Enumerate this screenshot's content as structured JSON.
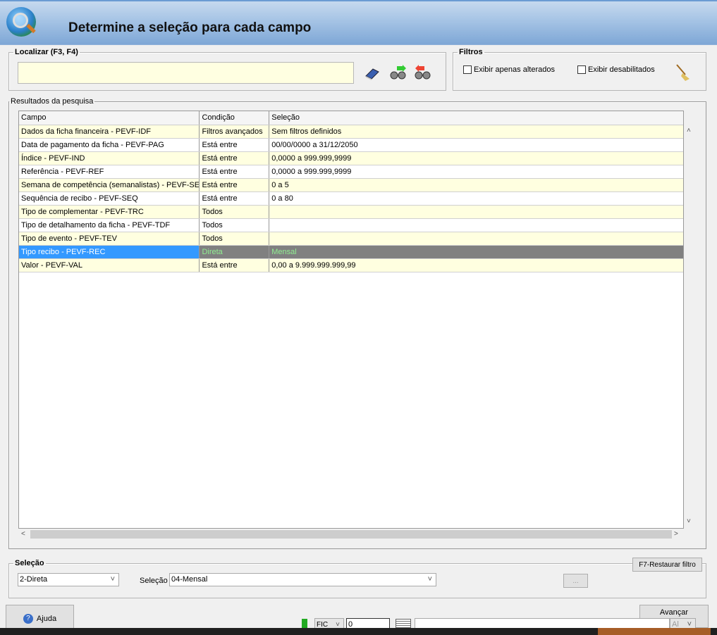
{
  "header": {
    "title": "Determine a seleção para cada campo",
    "icon": "globe-search-icon"
  },
  "localizar": {
    "legend": "Localizar (F3, F4)",
    "value": "",
    "icons": [
      "eraser-icon",
      "find-next-icon",
      "find-previous-icon"
    ]
  },
  "filtros": {
    "legend": "Filtros",
    "options": [
      {
        "label": "Exibir apenas alterados",
        "checked": false
      },
      {
        "label": "Exibir desabilitados",
        "checked": false
      }
    ],
    "icon": "broom-icon"
  },
  "results": {
    "legend": "Resultados da pesquisa",
    "columns": [
      "Campo",
      "Condição",
      "Seleção"
    ],
    "rows": [
      [
        "Dados da ficha financeira - PEVF-IDF",
        "Filtros avançados",
        "Sem filtros definidos"
      ],
      [
        "Data de pagamento da ficha - PEVF-PAG",
        "Está entre",
        "00/00/0000 a 31/12/2050"
      ],
      [
        "Índice - PEVF-IND",
        "Está entre",
        "0,0000 a 999.999,9999"
      ],
      [
        "Referência - PEVF-REF",
        "Está entre",
        "0,0000 a 999.999,9999"
      ],
      [
        "Semana de competência (semanalistas) - PEVF-SEM",
        "Está entre",
        "0 a 5"
      ],
      [
        "Sequência de recibo - PEVF-SEQ",
        "Está entre",
        "0 a 80"
      ],
      [
        "Tipo de complementar - PEVF-TRC",
        "Todos",
        ""
      ],
      [
        "Tipo de detalhamento da ficha - PEVF-TDF",
        "Todos",
        ""
      ],
      [
        "Tipo de evento - PEVF-TEV",
        "Todos",
        ""
      ],
      [
        "Tipo recibo - PEVF-REC",
        "Direta",
        "Mensal"
      ],
      [
        "Valor - PEVF-VAL",
        "Está entre",
        "0,00 a 9.999.999.999,99"
      ]
    ],
    "selected_row": 9
  },
  "selecao": {
    "legend": "Seleção",
    "restore_label": "F7-Restaurar filtro",
    "condition": "2-Direta",
    "value_label": "Seleção",
    "value": "04-Mensal",
    "ellipsis": "..."
  },
  "footer": {
    "help": "Ajuda",
    "next": "Avançar",
    "fic": "FIC",
    "num": "0",
    "al": "Al"
  }
}
